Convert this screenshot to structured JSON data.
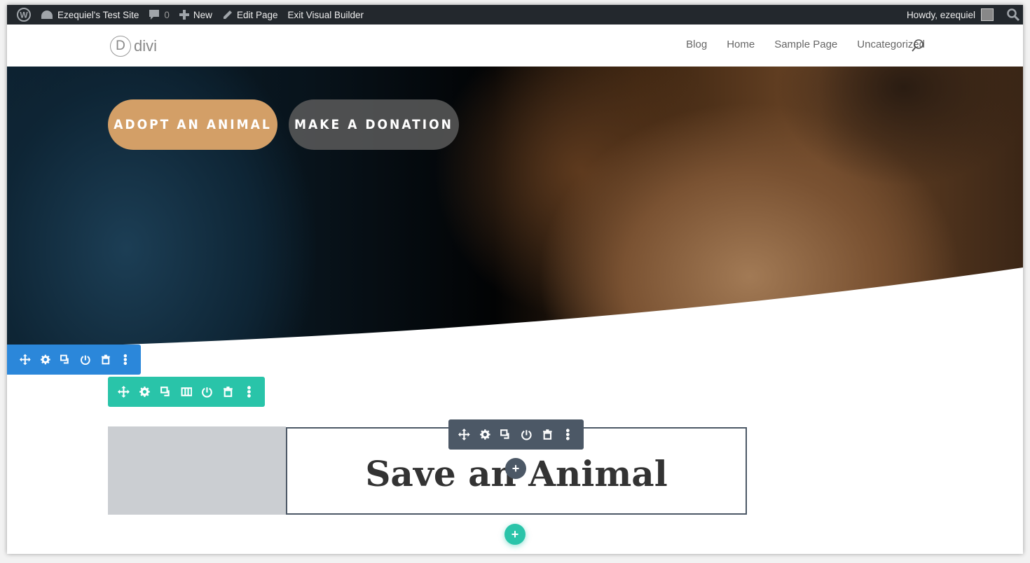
{
  "admin_bar": {
    "site_name": "Ezequiel's Test Site",
    "comments_count": "0",
    "new_label": "New",
    "edit_label": "Edit Page",
    "exit_label": "Exit Visual Builder",
    "greeting": "Howdy, ezequiel"
  },
  "header": {
    "logo_letter": "D",
    "logo_text": "divi",
    "nav": [
      "Blog",
      "Home",
      "Sample Page",
      "Uncategorized"
    ]
  },
  "hero": {
    "primary_button": "ADOPT AN ANIMAL",
    "secondary_button": "MAKE A DONATION"
  },
  "module": {
    "heading": "Save an Animal"
  },
  "colors": {
    "section": "#2b87da",
    "row": "#29c4a9",
    "module": "#4c5866",
    "primary_button": "#d39f67"
  }
}
